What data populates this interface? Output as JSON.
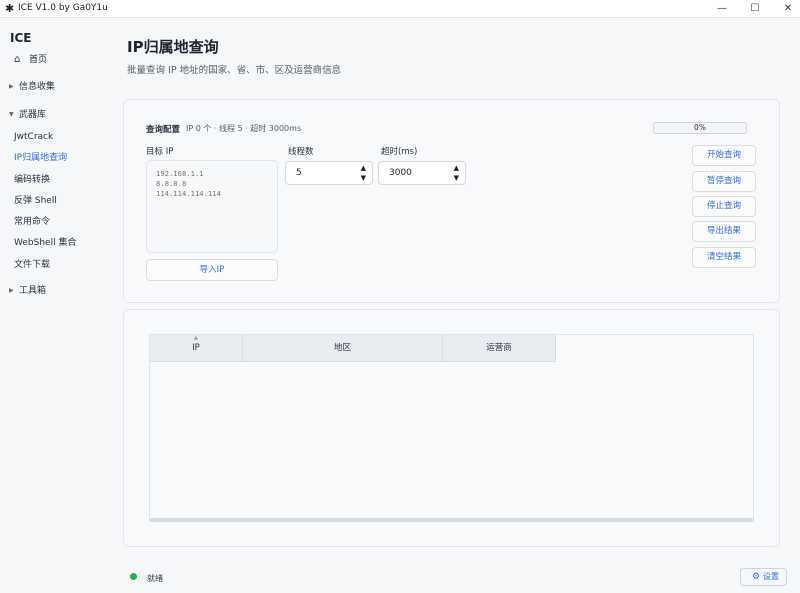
{
  "window": {
    "title": "ICE V1.0 by Ga0Y1u"
  },
  "sidebar": {
    "brand": "ICE",
    "home": "首页",
    "groups": {
      "info": "信息收集",
      "arsenal": "武器库",
      "tools": "工具箱"
    },
    "items": [
      "JwtCrack",
      "IP归属地查询",
      "编码转换",
      "反弹 Shell",
      "常用命令",
      "WebShell 集合",
      "文件下载"
    ],
    "active_index": 1
  },
  "page": {
    "title": "IP归属地查询",
    "subtitle": "批量查询 IP 地址的国家、省、市、区及运营商信息"
  },
  "config": {
    "title": "查询配置",
    "summary": "IP 0 个 · 线程 5 · 超时 3000ms",
    "progress": {
      "value": 0,
      "text": "0%"
    },
    "ip_label": "目标 IP",
    "ip_placeholder": "192.168.1.1\n8.8.8.8\n114.114.114.114",
    "threads_label": "线程数",
    "threads_value": "5",
    "timeout_label": "超时(ms)",
    "timeout_value": "3000",
    "import_label": "导入IP"
  },
  "actions": {
    "start": "开始查询",
    "pause": "暂停查询",
    "stop": "停止查询",
    "export": "导出结果",
    "clear": "清空结果"
  },
  "table": {
    "columns": [
      "IP",
      "地区",
      "运营商"
    ]
  },
  "status": {
    "text": "就绪",
    "color": "#22b14c",
    "settings_label": "设置"
  },
  "colors": {
    "accent": "#2f6fdd"
  }
}
